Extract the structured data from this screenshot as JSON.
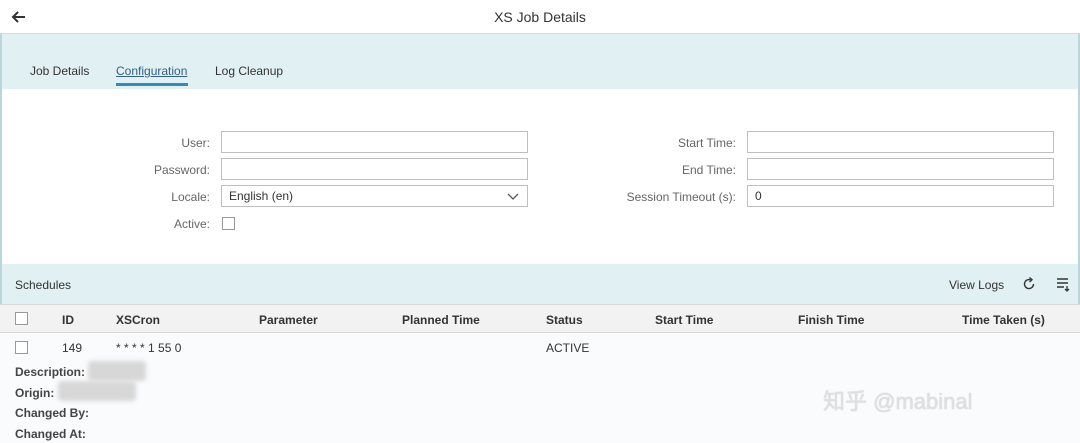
{
  "window": {
    "title": "XS Job Details"
  },
  "tabs": [
    {
      "label": "Job Details",
      "active": false
    },
    {
      "label": "Configuration",
      "active": true
    },
    {
      "label": "Log Cleanup",
      "active": false
    }
  ],
  "form": {
    "user": {
      "label": "User:",
      "value": ""
    },
    "password": {
      "label": "Password:",
      "value": ""
    },
    "locale": {
      "label": "Locale:",
      "value": "English (en)"
    },
    "active": {
      "label": "Active:",
      "checked": false
    },
    "start_time": {
      "label": "Start Time:",
      "value": ""
    },
    "end_time": {
      "label": "End Time:",
      "value": ""
    },
    "session_timeout": {
      "label": "Session Timeout (s):",
      "value": "0"
    }
  },
  "schedules": {
    "title": "Schedules",
    "view_logs_label": "View Logs",
    "columns": [
      "ID",
      "XSCron",
      "Parameter",
      "Planned Time",
      "Status",
      "Start Time",
      "Finish Time",
      "Time Taken (s)"
    ],
    "rows": [
      {
        "id": "149",
        "xscron": "* * * * 1 55 0",
        "parameter": "",
        "planned_time": "",
        "status": "ACTIVE",
        "start_time": "",
        "finish_time": "",
        "time_taken": ""
      }
    ],
    "details": {
      "description_label": "Description:",
      "origin_label": "Origin:",
      "changed_by_label": "Changed By:",
      "changed_at_label": "Changed At:"
    }
  },
  "watermark": "知乎 @mabinal",
  "icons": {
    "back": "arrow-left-icon",
    "dropdown": "chevron-down-icon",
    "refresh": "refresh-icon",
    "settings": "list-settings-icon"
  },
  "colors": {
    "header_band": "#e1f0f2",
    "tab_accent": "#2a8fbd",
    "table_header": "#f2f2f2"
  }
}
